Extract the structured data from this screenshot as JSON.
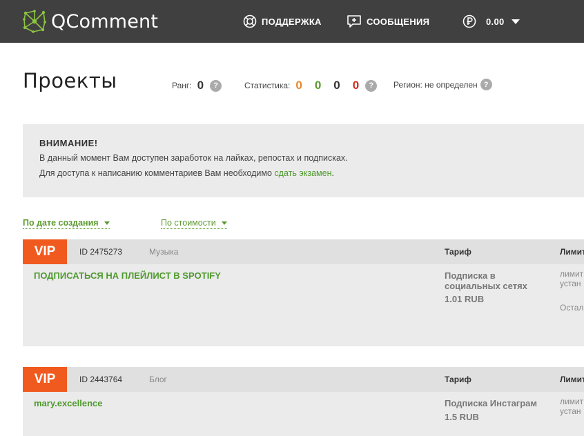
{
  "header": {
    "logo_text": "QComment",
    "support_label": "ПОДДЕРЖКА",
    "messages_label": "СООБЩЕНИЯ",
    "balance": "0.00"
  },
  "page": {
    "title": "Проекты",
    "rank_label": "Ранг:",
    "rank_value": "0",
    "stats_label": "Статистика:",
    "stats_values": [
      "0",
      "0",
      "0",
      "0"
    ],
    "region_label": "Регион: не определен",
    "help_glyph": "?"
  },
  "notice": {
    "title": "ВНИМАНИЕ!",
    "line1": "В данный момент Вам доступен заработок на лайках, репостах и подписках.",
    "line2_prefix": "Для доступа к написанию комментариев Вам необходимо ",
    "line2_link": "сдать экзамен",
    "line2_suffix": "."
  },
  "sort": {
    "by_date": "По дате создания",
    "by_cost": "По стоимости"
  },
  "projects": [
    {
      "badge": "VIP",
      "id": "ID 2475273",
      "category": "Музыка",
      "tarif_header": "Тариф",
      "limit_header": "Лимит",
      "title": "ПОДПИСАТЬСЯ НА ПЛЕЙЛИСТ В SPOTIFY",
      "tarif": "Подписка в социальных сетях",
      "price": "1.01 RUB",
      "limit_line1": "лимит",
      "limit_line2": "устан",
      "limit_line3": "Остал"
    },
    {
      "badge": "VIP",
      "id": "ID 2443764",
      "category": "Блог",
      "tarif_header": "Тариф",
      "limit_header": "Лимит",
      "title": "mary.excellence",
      "tarif": "Подписка Инстаграм",
      "price": "1.5 RUB",
      "limit_line1": "лимит",
      "limit_line2": "устан"
    }
  ],
  "colors": {
    "topbar": "#404040",
    "accent_green": "#4e9a2d",
    "vip_orange": "#f15a1f",
    "stat_orange": "#e8852a",
    "stat_red": "#d42a1e"
  }
}
